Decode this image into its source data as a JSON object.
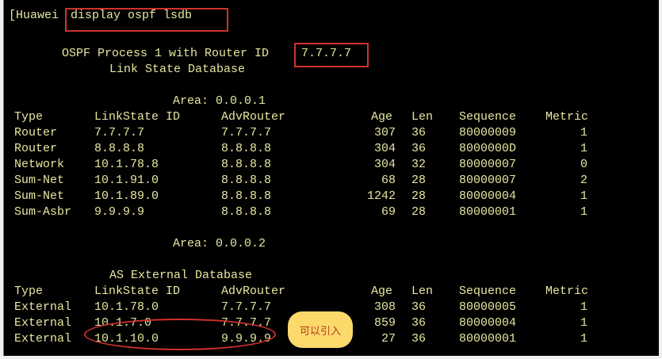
{
  "prompt": "[Huawei",
  "command": "display ospf lsdb",
  "process_line": "OSPF Process 1 with Router ID",
  "router_id": "7.7.7.7",
  "db_title": "Link State Database",
  "area1_label": "Area: 0.0.0.1",
  "area2_label": "Area: 0.0.0.2",
  "ext_title": "AS External Database",
  "headers": {
    "type": "Type",
    "lsid": "LinkState ID",
    "adv": "AdvRouter",
    "age": "Age",
    "len": "Len",
    "seq": "Sequence",
    "metric": "Metric"
  },
  "area1_rows": [
    {
      "type": "Router",
      "lsid": "7.7.7.7",
      "adv": "7.7.7.7",
      "age": "307",
      "len": "36",
      "seq": "80000009",
      "metric": "1"
    },
    {
      "type": "Router",
      "lsid": "8.8.8.8",
      "adv": "8.8.8.8",
      "age": "304",
      "len": "36",
      "seq": "8000000D",
      "metric": "1"
    },
    {
      "type": "Network",
      "lsid": "10.1.78.8",
      "adv": "8.8.8.8",
      "age": "304",
      "len": "32",
      "seq": "80000007",
      "metric": "0"
    },
    {
      "type": "Sum-Net",
      "lsid": "10.1.91.0",
      "adv": "8.8.8.8",
      "age": "68",
      "len": "28",
      "seq": "80000007",
      "metric": "2"
    },
    {
      "type": "Sum-Net",
      "lsid": "10.1.89.0",
      "adv": "8.8.8.8",
      "age": "1242",
      "len": "28",
      "seq": "80000004",
      "metric": "1"
    },
    {
      "type": "Sum-Asbr",
      "lsid": "9.9.9.9",
      "adv": "8.8.8.8",
      "age": "69",
      "len": "28",
      "seq": "80000001",
      "metric": "1"
    }
  ],
  "ext_rows": [
    {
      "type": "External",
      "lsid": "10.1.78.0",
      "adv": "7.7.7.7",
      "age": "308",
      "len": "36",
      "seq": "80000005",
      "metric": "1"
    },
    {
      "type": "External",
      "lsid": "10.1.7.0",
      "adv": "7.7.7.7",
      "age": "859",
      "len": "36",
      "seq": "80000004",
      "metric": "1"
    },
    {
      "type": "External",
      "lsid": "10.1.10.0",
      "adv": "9.9.9.9",
      "age": "27",
      "len": "36",
      "seq": "80000001",
      "metric": "1"
    }
  ],
  "annotation_note": "可以引入",
  "colors": {
    "terminal_bg": "#000000",
    "text": "#e6e6a0",
    "highlight": "#d0312d",
    "note_bg": "#fbd96b"
  }
}
